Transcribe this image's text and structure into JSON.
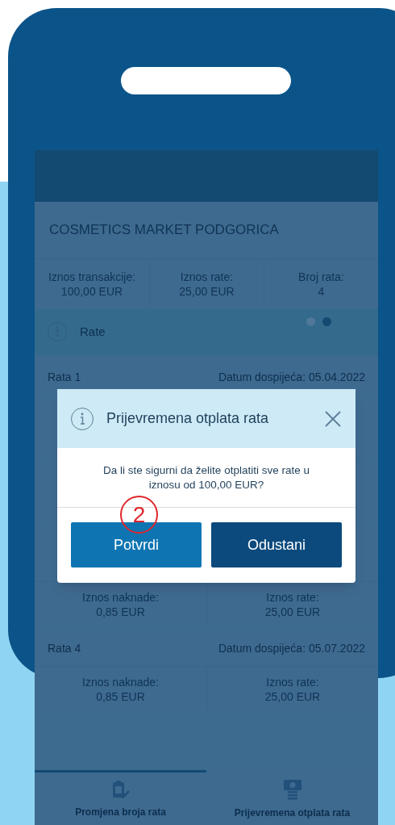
{
  "merchant": "COSMETICS MARKET PODGORICA",
  "summary": [
    {
      "label": "Iznos transakcije:",
      "value": "100,00 EUR"
    },
    {
      "label": "Iznos rate:",
      "value": "25,00 EUR"
    },
    {
      "label": "Broj rata:",
      "value": "4"
    }
  ],
  "section": {
    "title": "Rate",
    "pages": [
      {
        "selected": false
      },
      {
        "selected": true
      }
    ]
  },
  "installment_rows": [
    {
      "kind": "header",
      "label": "Rata 1",
      "due": "Datum dospijeća: 05.04.2022"
    },
    {
      "kind": "covered"
    },
    {
      "kind": "covered"
    },
    {
      "kind": "covered"
    },
    {
      "kind": "details",
      "fee_label": "Iznos naknade:",
      "fee": "0,85 EUR",
      "amount_label": "Iznos rate:",
      "amount": "25,00 EUR"
    },
    {
      "kind": "header",
      "label": "Rata 4",
      "due": "Datum dospijeća: 05.07.2022"
    },
    {
      "kind": "details",
      "fee_label": "Iznos naknade:",
      "fee": "0,85 EUR",
      "amount_label": "Iznos rate:",
      "amount": "25,00 EUR"
    }
  ],
  "tabs": [
    {
      "label": "Promjena broja rata",
      "selected": true
    },
    {
      "label": "Prijevremena otplata rata",
      "selected": false
    }
  ],
  "dialog": {
    "title": "Prijevremena otplata rata",
    "message": "Da li ste sigurni da želite otplatiti sve rate u iznosu od 100,00 EUR?",
    "buttons": [
      {
        "label": "Potvrdi",
        "kind": "primary"
      },
      {
        "label": "Odustani",
        "kind": "secondary"
      }
    ]
  },
  "step_marker": "2"
}
